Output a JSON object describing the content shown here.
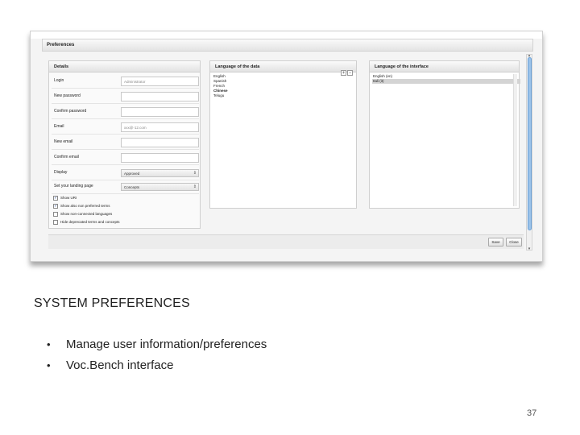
{
  "window": {
    "title": "Preferences"
  },
  "details": {
    "title": "Details",
    "fields": [
      {
        "label": "Login",
        "value": "Administrator",
        "type": "input"
      },
      {
        "label": "New password",
        "value": "",
        "type": "input"
      },
      {
        "label": "Confirm password",
        "value": "",
        "type": "input"
      },
      {
        "label": "Email",
        "value": "xxx@-12.com",
        "type": "input"
      },
      {
        "label": "New email",
        "value": "",
        "type": "input"
      },
      {
        "label": "Confirm email",
        "value": "",
        "type": "input"
      },
      {
        "label": "Display",
        "value": "Approved",
        "type": "select"
      },
      {
        "label": "Set your landing page",
        "value": "Concepts",
        "type": "select"
      }
    ],
    "checkboxes": [
      {
        "label": "Show URI",
        "checked": true
      },
      {
        "label": "Show also non preferred terms",
        "checked": true
      },
      {
        "label": "Show non-connected languages",
        "checked": false
      },
      {
        "label": "Hide deprecated terms and concepts",
        "checked": false
      }
    ]
  },
  "data_languages": {
    "title": "Language of the data",
    "add_icon": "plus-icon",
    "remove_icon": "minus-icon",
    "items": [
      "English",
      "Spanish",
      "French",
      "Chinese",
      "Telugu"
    ]
  },
  "interface_languages": {
    "title": "Language of the interface",
    "items": [
      {
        "label": "English (en)",
        "selected": false
      },
      {
        "label": "Itali (it)",
        "selected": true
      }
    ]
  },
  "buttons": {
    "save": "Save",
    "close": "Close"
  },
  "slide": {
    "title": "SYSTEM PREFERENCES",
    "bullet_glyph": "•",
    "bullets": [
      "Manage user information/preferences",
      "Voc.Bench interface"
    ],
    "page_number": "37"
  },
  "colors": {
    "scroll_thumb": "#9bc3ea",
    "selected_row": "#d4d4d4"
  }
}
